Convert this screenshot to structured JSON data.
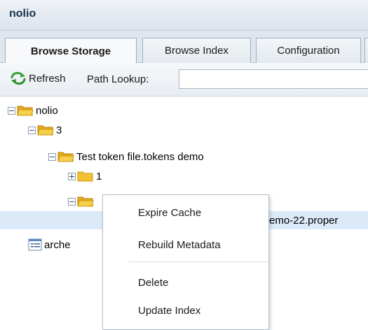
{
  "app": {
    "title": "nolio"
  },
  "tabs": [
    {
      "label": "Browse Storage",
      "active": true
    },
    {
      "label": "Browse Index",
      "active": false
    },
    {
      "label": "Configuration",
      "active": false
    }
  ],
  "toolbar": {
    "refresh_label": "Refresh",
    "path_label": "Path Lookup:",
    "path_value": ""
  },
  "tree": {
    "root": "nolio",
    "child_3": "3",
    "test_token": "Test token file.tokens demo",
    "child_1": "1",
    "hidden_folder": "",
    "file_suffix": "emo-22.proper",
    "arche": "arche"
  },
  "context_menu": {
    "items": [
      "Expire Cache",
      "Rebuild Metadata",
      "Delete",
      "Update Index"
    ]
  },
  "colors": {
    "selection": "#dce9f8",
    "folder": "#f2c230",
    "refresh_icon": "#3aa23a"
  }
}
